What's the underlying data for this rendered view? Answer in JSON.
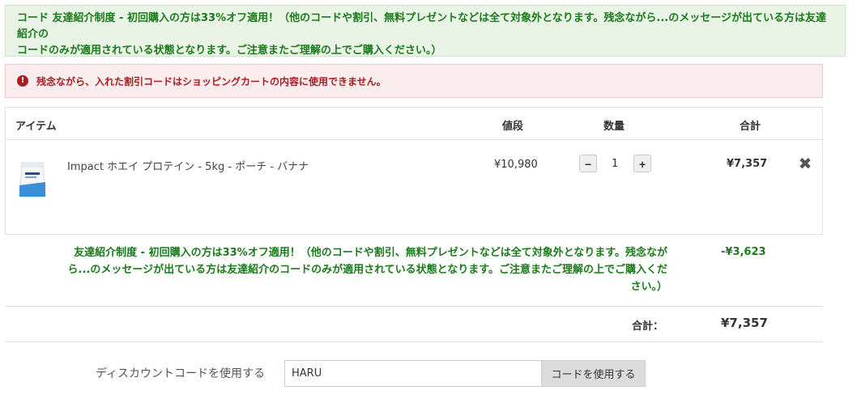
{
  "notices": {
    "success_line1": "コード 友達紹介制度 - 初回購入の方は33%オフ適用！（他のコードや割引、無料プレゼントなどは全て対象外となります。残念ながら...のメッセージが出ている方は友達紹介の",
    "success_line2": "コードのみが適用されている状態となります。ご注意またご理解の上でご購入ください。）",
    "error_icon": "!",
    "error": "残念ながら、入れた割引コードはショッピングカートの内容に使用できません。"
  },
  "cart": {
    "headers": {
      "item": "アイテム",
      "price": "値段",
      "qty": "数量",
      "total": "合計"
    },
    "item": {
      "image": "protein-pouch-image",
      "name": "Impact ホエイ プロテイン - 5kg - ポーチ - バナナ",
      "price": "¥10,980",
      "qty": "1",
      "minus": "−",
      "plus": "+",
      "line_total": "¥7,357",
      "remove": "✖"
    },
    "discount": {
      "line1": "友達紹介制度 - 初回購入の方は33%オフ適用！（他のコードや割引、無料プレゼントなどは全て対象外となります。残念なが",
      "line2": "ら...のメッセージが出ている方は友達紹介のコードのみが適用されている状態となります。ご注意またご理解の上でご購入くだ",
      "line3": "さい。）",
      "amount": "-¥3,623"
    },
    "total_label": "合計：",
    "total_value": "¥7,357"
  },
  "discount_code": {
    "label": "ディスカウントコードを使用する",
    "value": "HARU",
    "button": "コードを使用する"
  },
  "colors": {
    "success_text": "#1b7a1b",
    "error_text": "#a81d23"
  }
}
